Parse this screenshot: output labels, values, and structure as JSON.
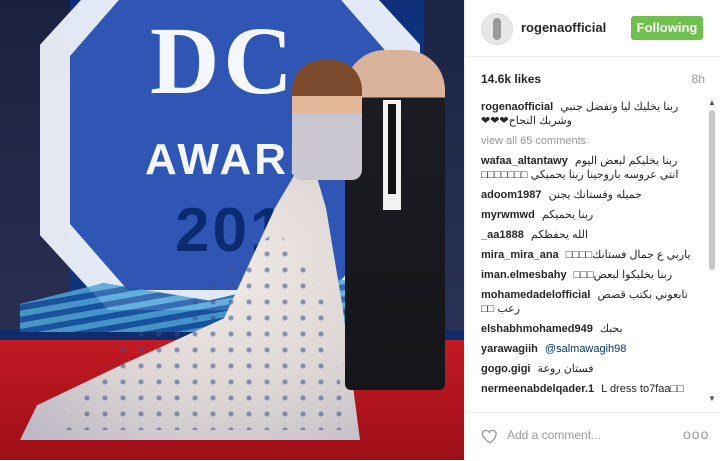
{
  "header": {
    "username": "rogenaofficial",
    "follow_label": "Following"
  },
  "meta": {
    "likes": "14.6k likes",
    "time": "8h"
  },
  "photo": {
    "backdrop_text_dc": "DC",
    "backdrop_text_sub": "D",
    "backdrop_text_awards": "AWARD",
    "backdrop_text_year": "201"
  },
  "caption": {
    "user": "rogenaofficial",
    "text": "ربنا يخليك ليا وتفضل جنبي وشريك النجاح❤❤❤"
  },
  "view_all": "view all 65 comments",
  "comments": [
    {
      "user": "wafaa_altantawy",
      "text": "ربنا يخليكم لبعض اليوم انتي عروسه باروجينا ربنا يحميكي □□□□□□□"
    },
    {
      "user": "adoom1987",
      "text": "جميله وفستانك يجنن"
    },
    {
      "user": "myrwmwd",
      "text": "ربنا يحميكم"
    },
    {
      "user": "_aa1888",
      "text": "الله يحفظكم"
    },
    {
      "user": "mira_mira_ana",
      "text": "ياربي ع جمال فستانك□□□□"
    },
    {
      "user": "iman.elmesbahy",
      "text": "ربنا يخليكوا لبعض□□□"
    },
    {
      "user": "mohamedadelofficial",
      "text": "تابعوني بكتب قصص رعب □□"
    },
    {
      "user": "elshabhmohamed949",
      "text": "بحبك"
    },
    {
      "user": "yarawagiih",
      "text": "@salmawagih98"
    },
    {
      "user": "gogo.gigi",
      "text": "فستان روعة"
    },
    {
      "user": "nermeenabdelqader.1",
      "text": "L dress to7faa□□"
    }
  ],
  "footer": {
    "add_comment_placeholder": "Add a comment...",
    "more_label": "ooo"
  },
  "colors": {
    "follow_button": "#70c050",
    "mention": "#003569",
    "muted": "#999999"
  }
}
